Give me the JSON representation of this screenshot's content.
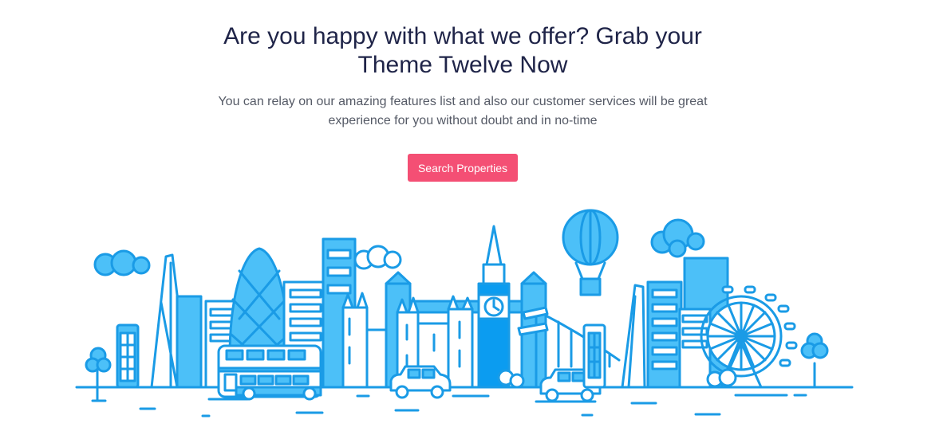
{
  "cta": {
    "headline_line1": "Are you happy with what we offer? Grab your",
    "headline_line2": "Theme Twelve Now",
    "subtext_line1": "You can relay on our amazing features list and also our customer services will be great",
    "subtext_line2": "experience for you without doubt and in no-time",
    "button_label": "Search Properties"
  },
  "colors": {
    "heading": "#1f2448",
    "body_text": "#555a66",
    "button": "#f44f74",
    "illustration_stroke": "#1a9be6",
    "illustration_fill": "#4cc0f8"
  },
  "illustration": {
    "subject": "city-skyline-illustration"
  }
}
